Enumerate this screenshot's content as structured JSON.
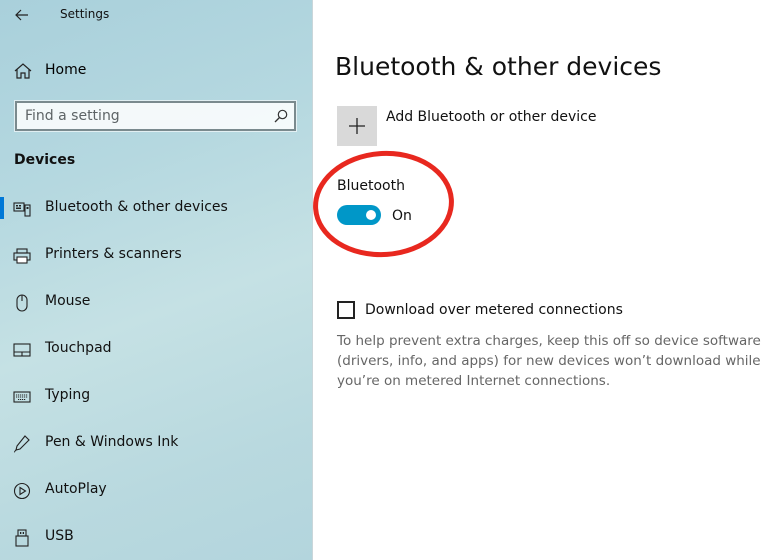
{
  "window": {
    "title": "Settings"
  },
  "sidebar": {
    "home_label": "Home",
    "search": {
      "placeholder": "Find a setting"
    },
    "section_heading": "Devices",
    "items": [
      {
        "label": "Bluetooth & other devices",
        "icon": "bluetooth-devices-icon",
        "selected": true
      },
      {
        "label": "Printers & scanners",
        "icon": "printer-icon",
        "selected": false
      },
      {
        "label": "Mouse",
        "icon": "mouse-icon",
        "selected": false
      },
      {
        "label": "Touchpad",
        "icon": "touchpad-icon",
        "selected": false
      },
      {
        "label": "Typing",
        "icon": "keyboard-icon",
        "selected": false
      },
      {
        "label": "Pen & Windows Ink",
        "icon": "pen-icon",
        "selected": false
      },
      {
        "label": "AutoPlay",
        "icon": "autoplay-icon",
        "selected": false
      },
      {
        "label": "USB",
        "icon": "usb-icon",
        "selected": false
      }
    ]
  },
  "main": {
    "page_title": "Bluetooth & other devices",
    "add_device_label": "Add Bluetooth or other device",
    "bluetooth_label": "Bluetooth",
    "bluetooth_state": "On",
    "bluetooth_on": true,
    "metered_label": "Download over metered connections",
    "metered_checked": false,
    "metered_help": "To help prevent extra charges, keep this off so device software (drivers, info, and apps) for new devices won’t download while you’re on metered Internet connections."
  },
  "colors": {
    "accent": "#0078d7",
    "toggle_on": "#0097c8",
    "annotation_ring": "#e8281f"
  }
}
